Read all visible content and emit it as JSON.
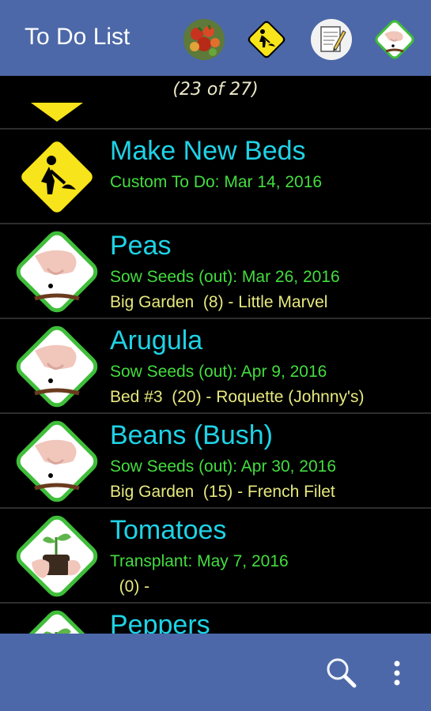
{
  "app": {
    "title": "To Do List"
  },
  "toolbar": {
    "icons": [
      "vegetables-icon",
      "construction-icon",
      "notepad-icon",
      "sow-seeds-icon"
    ]
  },
  "counter": "(23 of 27)",
  "items": [
    {
      "name": "Make New Beds",
      "task": "Custom To Do: Mar 14, 2016",
      "detail": "",
      "icon": "construction-icon"
    },
    {
      "name": "Peas",
      "task": "Sow Seeds (out): Mar 26, 2016",
      "detail": "Big Garden  (8) - Little Marvel",
      "icon": "sow-seeds-icon"
    },
    {
      "name": "Arugula",
      "task": "Sow Seeds (out): Apr 9, 2016",
      "detail": "Bed #3  (20) - Roquette (Johnny's)",
      "icon": "sow-seeds-icon"
    },
    {
      "name": "Beans (Bush)",
      "task": "Sow Seeds (out): Apr 30, 2016",
      "detail": "Big Garden  (15) - French Filet",
      "icon": "sow-seeds-icon"
    },
    {
      "name": "Tomatoes",
      "task": "Transplant: May 7, 2016",
      "detail": "  (0) -",
      "icon": "transplant-icon"
    },
    {
      "name": "Peppers",
      "task": "",
      "detail": "",
      "icon": "transplant-icon"
    }
  ],
  "colors": {
    "bar": "#4c68a8",
    "name": "#1ed3e6",
    "task": "#43dd3f",
    "detail": "#e7e97e",
    "warning_yellow": "#f7e41a",
    "green_border": "#3fbe3a"
  }
}
